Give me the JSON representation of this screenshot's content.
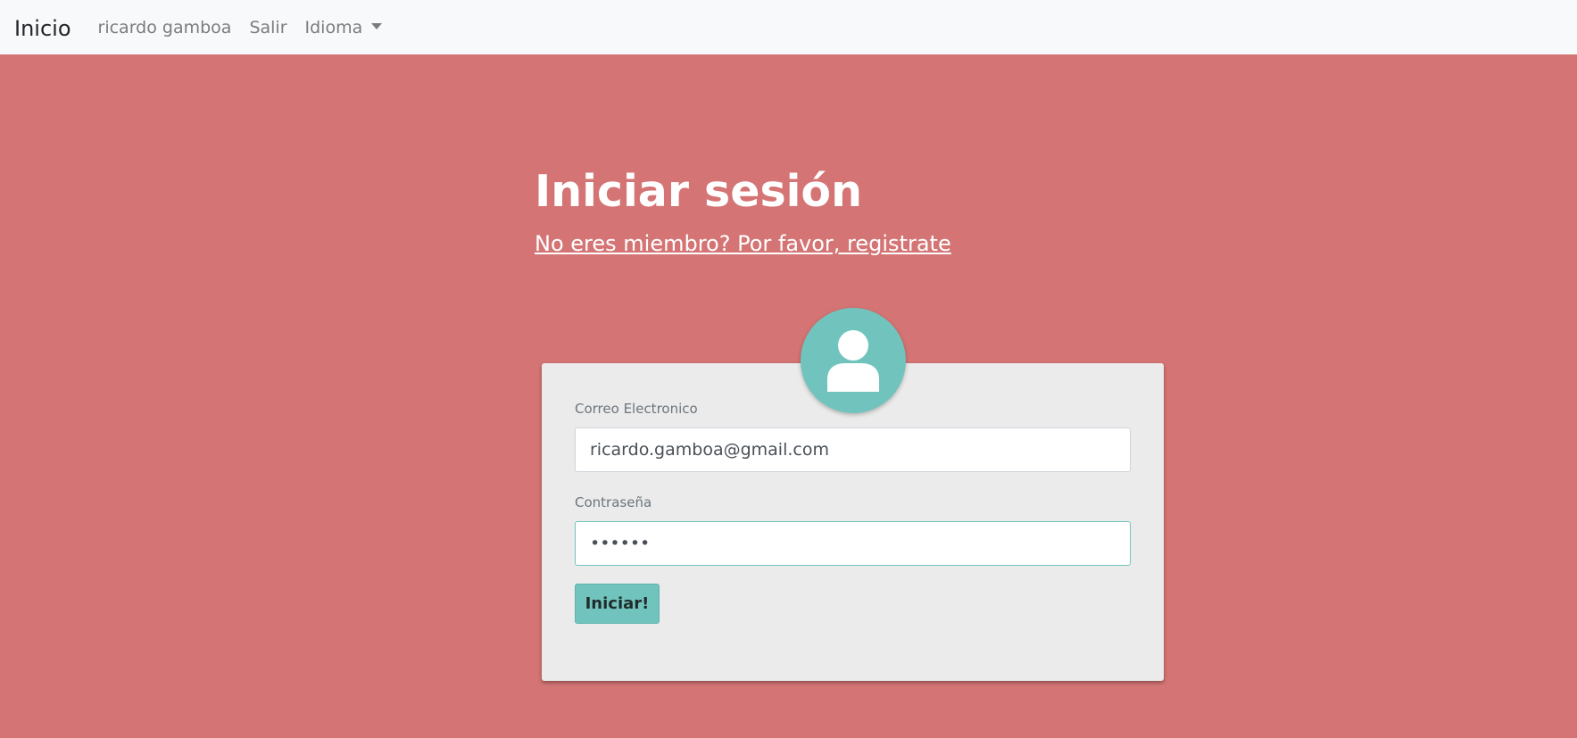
{
  "navbar": {
    "brand": "Inicio",
    "user": "ricardo gamboa",
    "logout": "Salir",
    "language": "Idioma"
  },
  "header": {
    "title": "Iniciar sesión",
    "register_link": "No eres miembro? Por favor, registrate"
  },
  "form": {
    "email_label": "Correo Electronico",
    "email_value": "ricardo.gamboa@gmail.com",
    "password_label": "Contraseña",
    "password_value": "••••••",
    "submit_label": "Iniciar!"
  },
  "colors": {
    "background": "#d47474",
    "accent": "#71c4bd",
    "card": "#ebebeb",
    "navbar": "#f8f9fa"
  },
  "icons": {
    "avatar": "user-icon",
    "dropdown": "caret-down-icon"
  }
}
